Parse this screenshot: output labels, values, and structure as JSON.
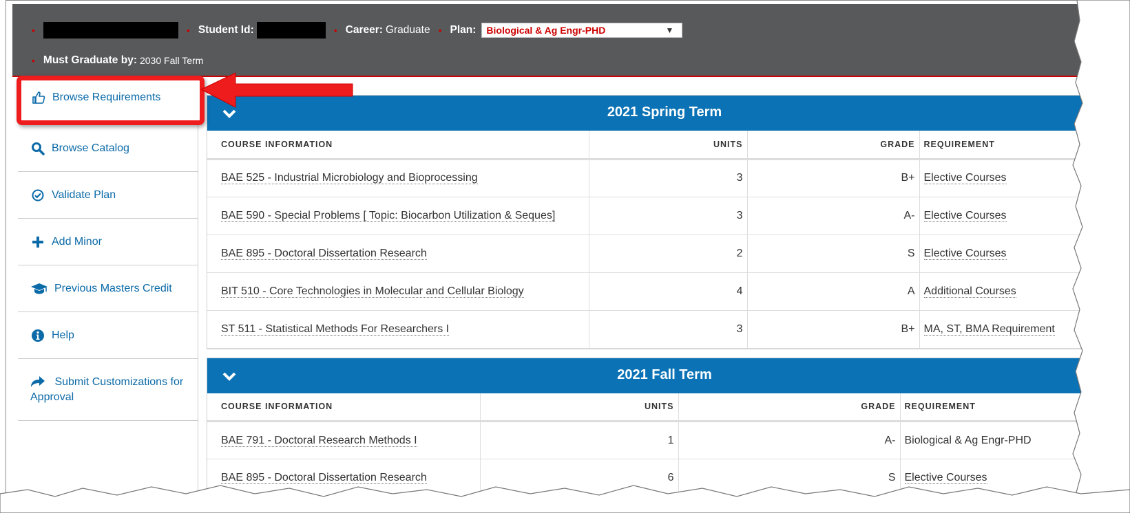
{
  "header": {
    "student_id_label": "Student Id:",
    "career_label": "Career:",
    "career_value": "Graduate",
    "plan_label": "Plan:",
    "plan_selected": "Biological & Ag Engr-PHD",
    "graduate_by_label": "Must Graduate by:",
    "graduate_by_value": "2030 Fall Term"
  },
  "sidebar": {
    "items": [
      {
        "label": "Browse Requirements",
        "icon": "thumbs-up-icon"
      },
      {
        "label": "Browse Catalog",
        "icon": "search-icon"
      },
      {
        "label": "Validate Plan",
        "icon": "check-circle-icon"
      },
      {
        "label": "Add Minor",
        "icon": "plus-icon"
      },
      {
        "label": "Previous Masters Credit",
        "icon": "graduation-cap-icon"
      },
      {
        "label": "Help",
        "icon": "info-circle-icon"
      },
      {
        "label": "Submit Customizations for Approval",
        "icon": "share-arrow-icon"
      }
    ]
  },
  "columns": {
    "course": "COURSE INFORMATION",
    "units": "UNITS",
    "grade": "GRADE",
    "requirement": "REQUIREMENT"
  },
  "terms": [
    {
      "title": "2021 Spring Term",
      "rows": [
        {
          "course": "BAE 525 - Industrial Microbiology and Bioprocessing",
          "units": "3",
          "grade": "B+",
          "requirement": "Elective Courses"
        },
        {
          "course": "BAE 590 - Special Problems [ Topic: Biocarbon Utilization & Seques]",
          "units": "3",
          "grade": "A-",
          "requirement": "Elective Courses"
        },
        {
          "course": "BAE 895 - Doctoral Dissertation Research",
          "units": "2",
          "grade": "S",
          "requirement": "Elective Courses"
        },
        {
          "course": "BIT 510 - Core Technologies in Molecular and Cellular Biology",
          "units": "4",
          "grade": "A",
          "requirement": "Additional Courses"
        },
        {
          "course": "ST 511 - Statistical Methods For Researchers I",
          "units": "3",
          "grade": "B+",
          "requirement": "MA, ST, BMA Requirement"
        }
      ]
    },
    {
      "title": "2021 Fall Term",
      "rows": [
        {
          "course": "BAE 791 - Doctoral Research Methods I",
          "units": "1",
          "grade": "A-",
          "requirement": "Biological & Ag Engr-PHD"
        },
        {
          "course": "BAE 895 - Doctoral Dissertation Research",
          "units": "6",
          "grade": "S",
          "requirement": "Elective Courses"
        }
      ]
    }
  ],
  "colors": {
    "header_bg": "#58595b",
    "accent_red": "#cc0000",
    "term_blue": "#0a72b5",
    "link_blue": "#0b6aa8",
    "annotation_red": "#ee1c1c"
  }
}
